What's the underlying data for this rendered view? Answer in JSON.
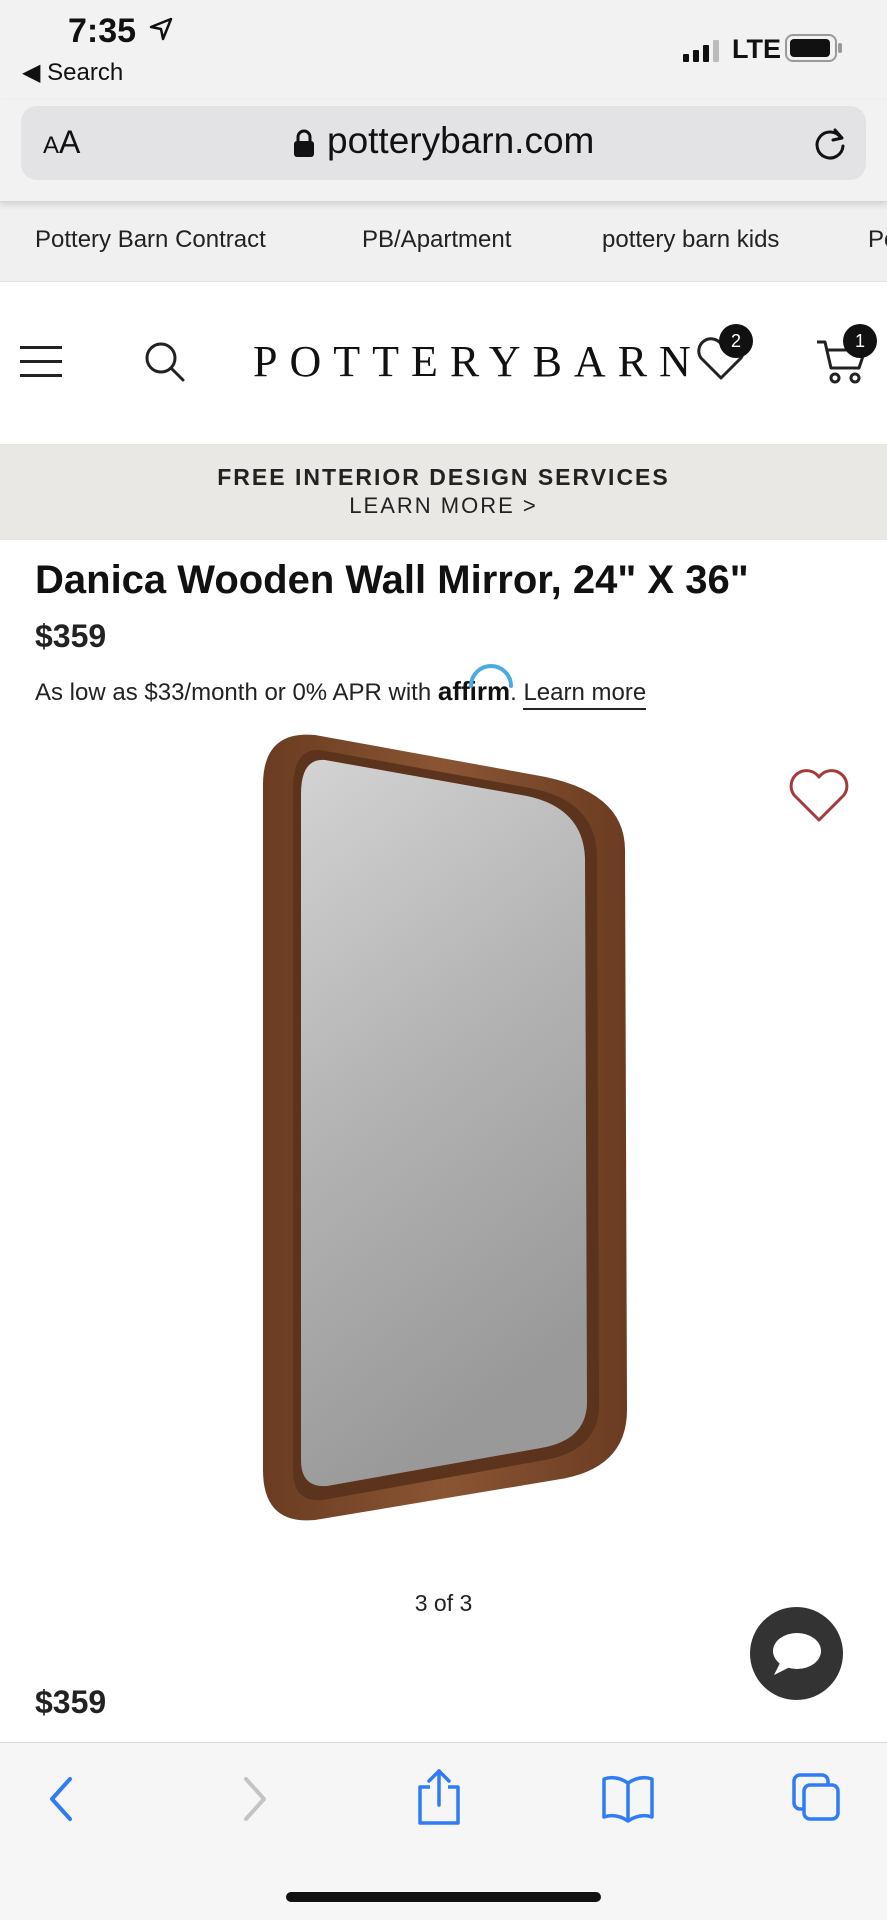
{
  "status_bar": {
    "time": "7:35",
    "back_label": "◀ Search",
    "network": "LTE"
  },
  "browser": {
    "text_size_label": "AA",
    "url": "potterybarn.com"
  },
  "subnav": {
    "items": [
      "Pottery Barn Contract",
      "PB/Apartment",
      "pottery barn kids",
      "Po"
    ]
  },
  "header": {
    "logo": "POTTERYBARN",
    "favorites_count": "2",
    "cart_count": "1"
  },
  "promo": {
    "title": "FREE INTERIOR DESIGN SERVICES",
    "link": "LEARN MORE >"
  },
  "product": {
    "title": "Danica Wooden Wall Mirror, 24\" X 36\"",
    "price": "$359",
    "financing_prefix": "As low as $33/month or 0% APR with",
    "affirm_brand": "affirm",
    "financing_suffix": ".",
    "learn_more": "Learn more",
    "carousel_position": "3 of 3",
    "sticky_price": "$359"
  },
  "colors": {
    "frame": "#7a4a2c",
    "heart": "#a63a3a",
    "affirm_accent": "#4aabe0",
    "toolbar_blue": "#2f7cf6"
  }
}
